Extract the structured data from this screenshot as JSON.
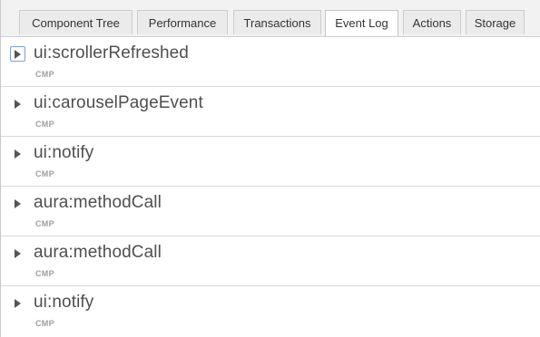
{
  "tabs": [
    {
      "label": "Component Tree"
    },
    {
      "label": "Performance"
    },
    {
      "label": "Transactions"
    },
    {
      "label": "Event Log",
      "active": true
    },
    {
      "label": "Actions"
    },
    {
      "label": "Storage"
    }
  ],
  "events": [
    {
      "name": "ui:scrollerRefreshed",
      "type": "CMP",
      "icon": "expand-arrow-icon"
    },
    {
      "name": "ui:carouselPageEvent",
      "type": "CMP",
      "icon": "expand-arrow-icon"
    },
    {
      "name": "ui:notify",
      "type": "CMP",
      "icon": "expand-arrow-icon"
    },
    {
      "name": "aura:methodCall",
      "type": "CMP",
      "icon": "expand-arrow-icon"
    },
    {
      "name": "aura:methodCall",
      "type": "CMP",
      "icon": "expand-arrow-icon"
    },
    {
      "name": "ui:notify",
      "type": "CMP",
      "icon": "expand-arrow-icon"
    }
  ],
  "colors": {
    "tab_bar_bg": "#f2f2f2",
    "active_tab_bg": "#ffffff",
    "focus_ring": "#7aa2d6",
    "event_name": "#4f4f4f",
    "event_type": "#9e9e9e"
  }
}
